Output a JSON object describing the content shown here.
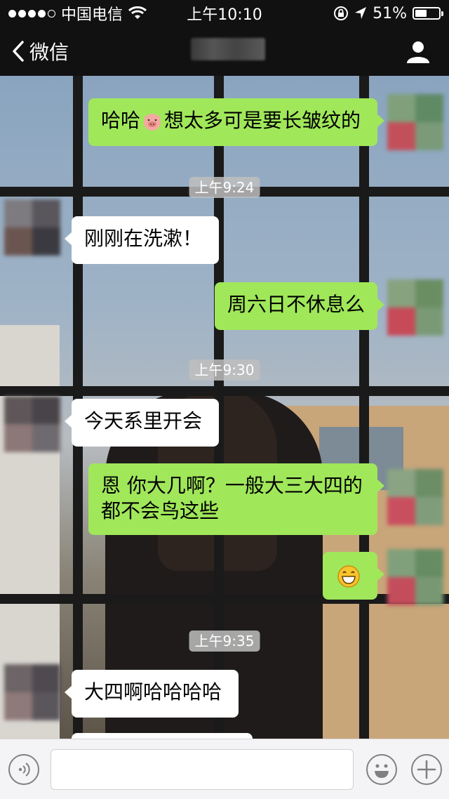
{
  "status_bar": {
    "carrier": "中国电信",
    "time": "上午10:10",
    "battery": "51%",
    "battery_level": 0.51,
    "icons": [
      "signal-dots-icon",
      "wifi-icon",
      "orientation-lock-icon",
      "location-icon",
      "battery-icon"
    ]
  },
  "nav": {
    "back_label": "微信",
    "back_icon": "chevron-left-icon",
    "profile_icon": "person-icon"
  },
  "messages": {
    "m1": {
      "side": "out",
      "parts": [
        "哈哈",
        "想太多可是要长皱纹的"
      ],
      "emoji": "pig-face-icon"
    },
    "t1": "上午9:24",
    "m2": {
      "side": "in",
      "text": "刚刚在洗漱！"
    },
    "m3": {
      "side": "out",
      "text": "周六日不休息么"
    },
    "t2": "上午9:30",
    "m4": {
      "side": "in",
      "text": "今天系里开会"
    },
    "m5": {
      "side": "out",
      "line1": "恩 你大几啊？一般大三大四的",
      "line2": "都不会鸟这些"
    },
    "m6": {
      "side": "out",
      "emoji": "grinning-face-icon"
    },
    "t3": "上午9:35",
    "m7": {
      "side": "in",
      "text": "大四啊哈哈哈哈"
    }
  },
  "input_bar": {
    "voice_icon": "voice-icon",
    "emoji_icon": "smiley-icon",
    "plus_icon": "plus-icon"
  },
  "colors": {
    "bar_bg": "#111111",
    "bubble_out": "#a0e75a",
    "bubble_in": "#ffffff",
    "timestamp_bg": "#bebebe"
  }
}
